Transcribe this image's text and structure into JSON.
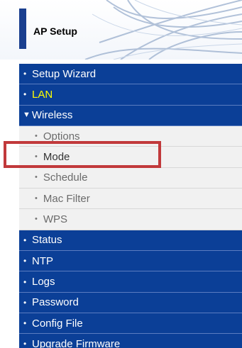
{
  "header": {
    "title": "AP Setup"
  },
  "menu": {
    "items": [
      {
        "label": "Setup Wizard"
      },
      {
        "label": "LAN"
      },
      {
        "label": "Wireless"
      },
      {
        "label": "Status"
      },
      {
        "label": "NTP"
      },
      {
        "label": "Logs"
      },
      {
        "label": "Password"
      },
      {
        "label": "Config File"
      },
      {
        "label": "Upgrade Firmware"
      }
    ],
    "wireless_sub": [
      {
        "label": "Options"
      },
      {
        "label": "Mode"
      },
      {
        "label": "Schedule"
      },
      {
        "label": "Mac Filter"
      },
      {
        "label": "WPS"
      }
    ],
    "active_text_color": "#ffff00",
    "nav_bg": "#0b3f97",
    "highlight_color": "#c1393b"
  }
}
